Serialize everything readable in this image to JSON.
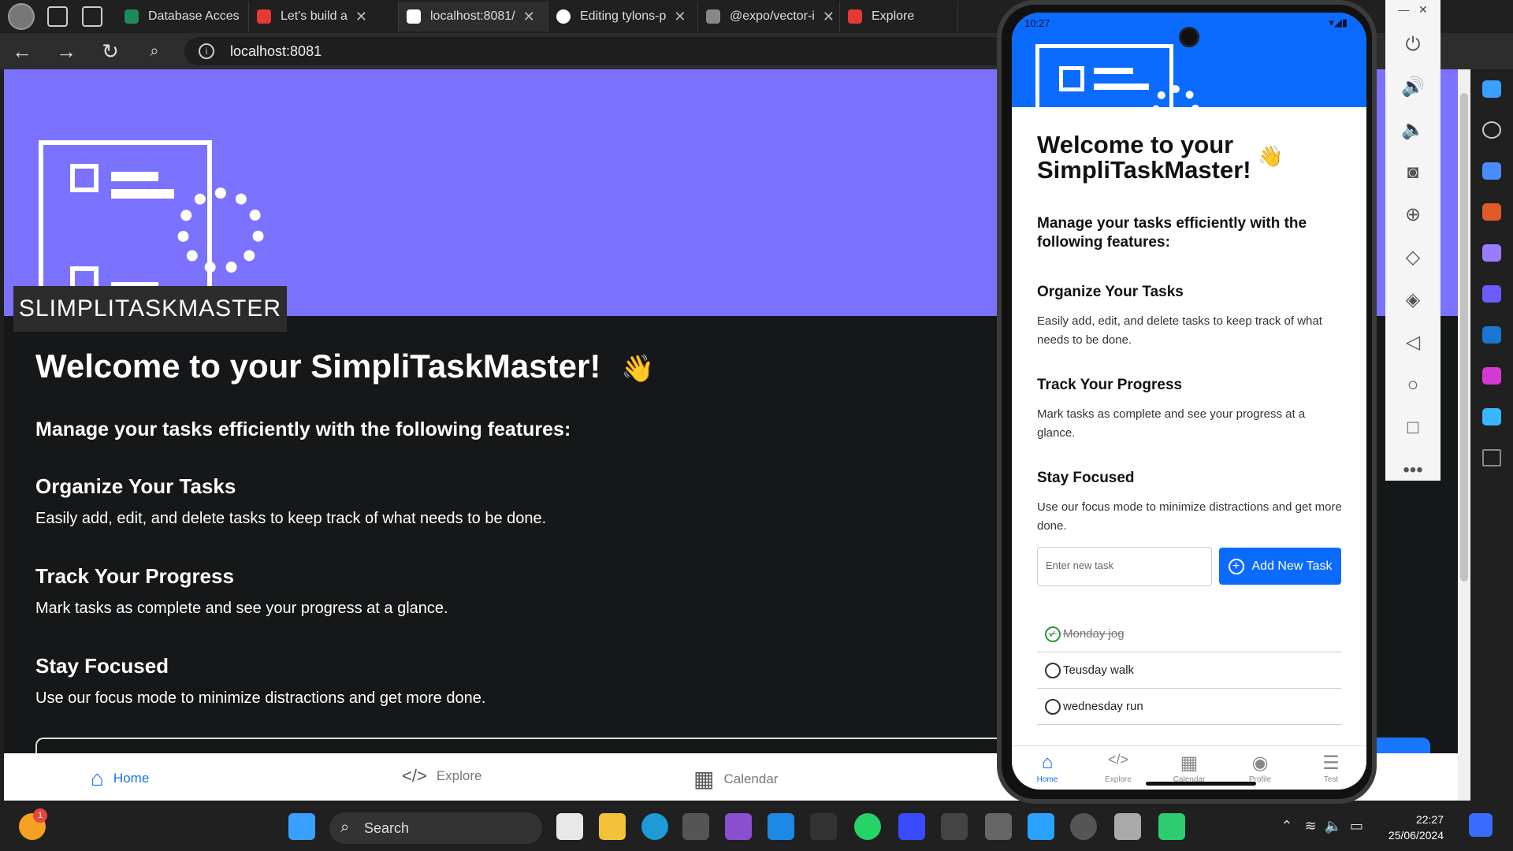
{
  "browser": {
    "tabs": [
      {
        "label": "Database Acces",
        "favicon_color": "#1e8a5a"
      },
      {
        "label": "Let's build a",
        "favicon_color": "#e53935"
      },
      {
        "label": "localhost:8081/",
        "favicon_color": "#ffffff"
      },
      {
        "label": "Editing tylons-p",
        "favicon_color": "#ffffff"
      },
      {
        "label": "@expo/vector-i",
        "favicon_color": "#888888"
      },
      {
        "label": "Explore",
        "favicon_color": "#e53935"
      }
    ],
    "url": "localhost:8081"
  },
  "web": {
    "logo_label": "SLIMPLITASKMASTER",
    "title": "Welcome to your SimpliTaskMaster!",
    "wave": "👋",
    "subtitle": "Manage your tasks efficiently with the following features:",
    "features": [
      {
        "title": "Organize Your Tasks",
        "desc": "Easily add, edit, and delete tasks to keep track of what needs to be done."
      },
      {
        "title": "Track Your Progress",
        "desc": "Mark tasks as complete and see your progress at a glance."
      },
      {
        "title": "Stay Focused",
        "desc": "Use our focus mode to minimize distractions and get more done."
      }
    ],
    "tabs": [
      {
        "label": "Home",
        "icon": "⌂"
      },
      {
        "label": "Explore",
        "icon": "</>"
      },
      {
        "label": "Calendar",
        "icon": "▦"
      }
    ]
  },
  "phone": {
    "time": "10:27",
    "title_line1": "Welcome to your",
    "title_line2": "SimpliTaskMaster!",
    "wave": "👋",
    "subtitle": "Manage your tasks efficiently with the following features:",
    "features": [
      {
        "title": "Organize Your Tasks",
        "desc": "Easily add, edit, and delete tasks to keep track of what needs to be done."
      },
      {
        "title": "Track Your Progress",
        "desc": "Mark tasks as complete and see your progress at a glance."
      },
      {
        "title": "Stay Focused",
        "desc": "Use our focus mode to minimize distractions and get more done."
      }
    ],
    "input_placeholder": "Enter new task",
    "add_button": "Add New Task",
    "tasks": [
      {
        "text": "Monday jog",
        "done": true
      },
      {
        "text": "Teusday walk",
        "done": false
      },
      {
        "text": "wednesday run",
        "done": false
      }
    ],
    "tabs": [
      {
        "label": "Home",
        "icon": "⌂"
      },
      {
        "label": "Explore",
        "icon": "</>"
      },
      {
        "label": "Calendar",
        "icon": "▦"
      },
      {
        "label": "Profile",
        "icon": "◉"
      },
      {
        "label": "Test",
        "icon": "☰"
      }
    ]
  },
  "taskbar": {
    "search_label": "Search",
    "time": "22:27",
    "date": "25/06/2024",
    "notification_count": "1"
  }
}
